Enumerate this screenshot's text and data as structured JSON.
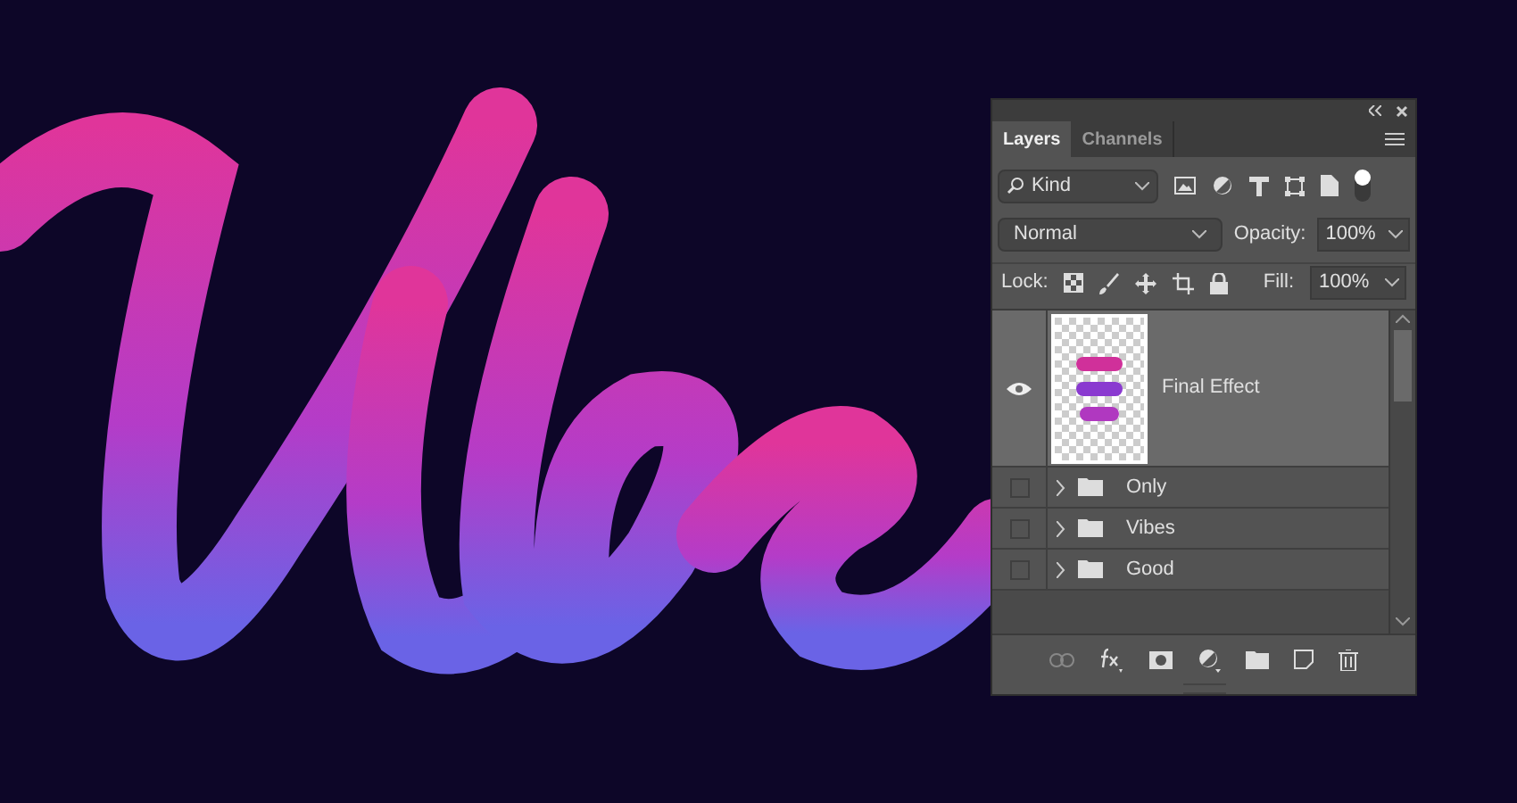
{
  "panel": {
    "tabs": [
      {
        "label": "Layers",
        "selected": true
      },
      {
        "label": "Channels",
        "selected": false
      }
    ],
    "filter": {
      "value": "Kind"
    },
    "blend_mode": {
      "value": "Normal"
    },
    "opacity": {
      "label": "Opacity:",
      "value": "100%"
    },
    "lock": {
      "label": "Lock:"
    },
    "fill": {
      "label": "Fill:",
      "value": "100%"
    },
    "layers": [
      {
        "name": "Final Effect",
        "kind": "layer",
        "visible": true,
        "selected": true
      },
      {
        "name": "Only",
        "kind": "group",
        "visible": false,
        "selected": false
      },
      {
        "name": "Vibes",
        "kind": "group",
        "visible": false,
        "selected": false
      },
      {
        "name": "Good",
        "kind": "group",
        "visible": false,
        "selected": false
      }
    ]
  }
}
